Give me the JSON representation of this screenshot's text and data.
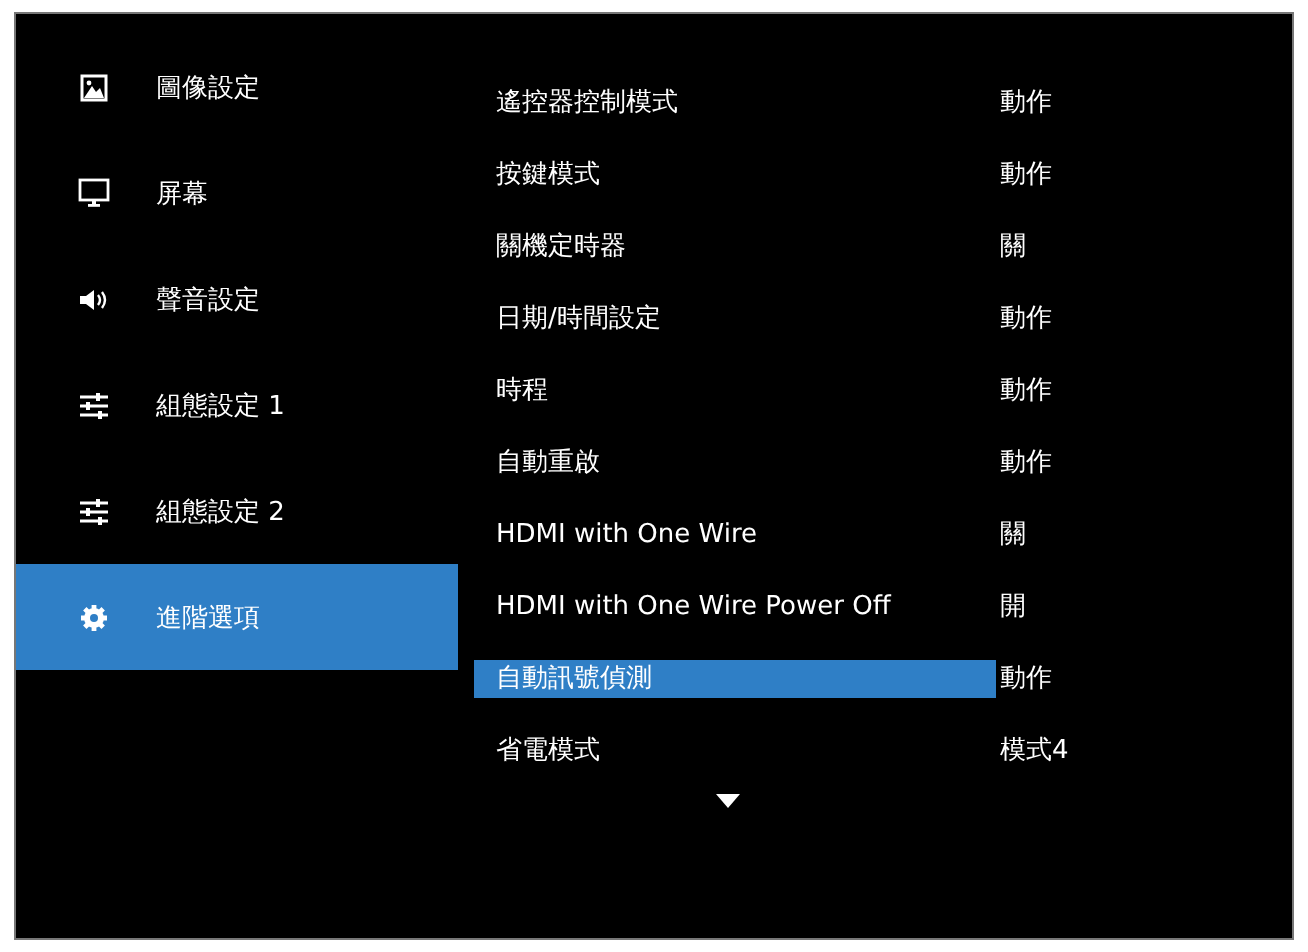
{
  "sidebar": {
    "items": [
      {
        "label": "圖像設定",
        "kind": "picture",
        "selected": false
      },
      {
        "label": "屏幕",
        "kind": "monitor",
        "selected": false
      },
      {
        "label": "聲音設定",
        "kind": "speaker",
        "selected": false
      },
      {
        "label": "組態設定 1",
        "kind": "sliders",
        "selected": false
      },
      {
        "label": "組態設定 2",
        "kind": "sliders",
        "selected": false
      },
      {
        "label": "進階選項",
        "kind": "gear",
        "selected": true
      }
    ]
  },
  "settings": [
    {
      "label": "遙控器控制模式",
      "value": "動作",
      "selected": false
    },
    {
      "label": "按鍵模式",
      "value": "動作",
      "selected": false
    },
    {
      "label": "關機定時器",
      "value": "關",
      "selected": false
    },
    {
      "label": "日期/時間設定",
      "value": "動作",
      "selected": false
    },
    {
      "label": "時程",
      "value": "動作",
      "selected": false
    },
    {
      "label": "自動重啟",
      "value": "動作",
      "selected": false
    },
    {
      "label": "HDMI with One Wire",
      "value": "關",
      "selected": false
    },
    {
      "label": "HDMI with One Wire Power Off",
      "value": "開",
      "selected": false
    },
    {
      "label": "自動訊號偵測",
      "value": "動作",
      "selected": true
    },
    {
      "label": "省電模式",
      "value": "模式4",
      "selected": false
    }
  ]
}
